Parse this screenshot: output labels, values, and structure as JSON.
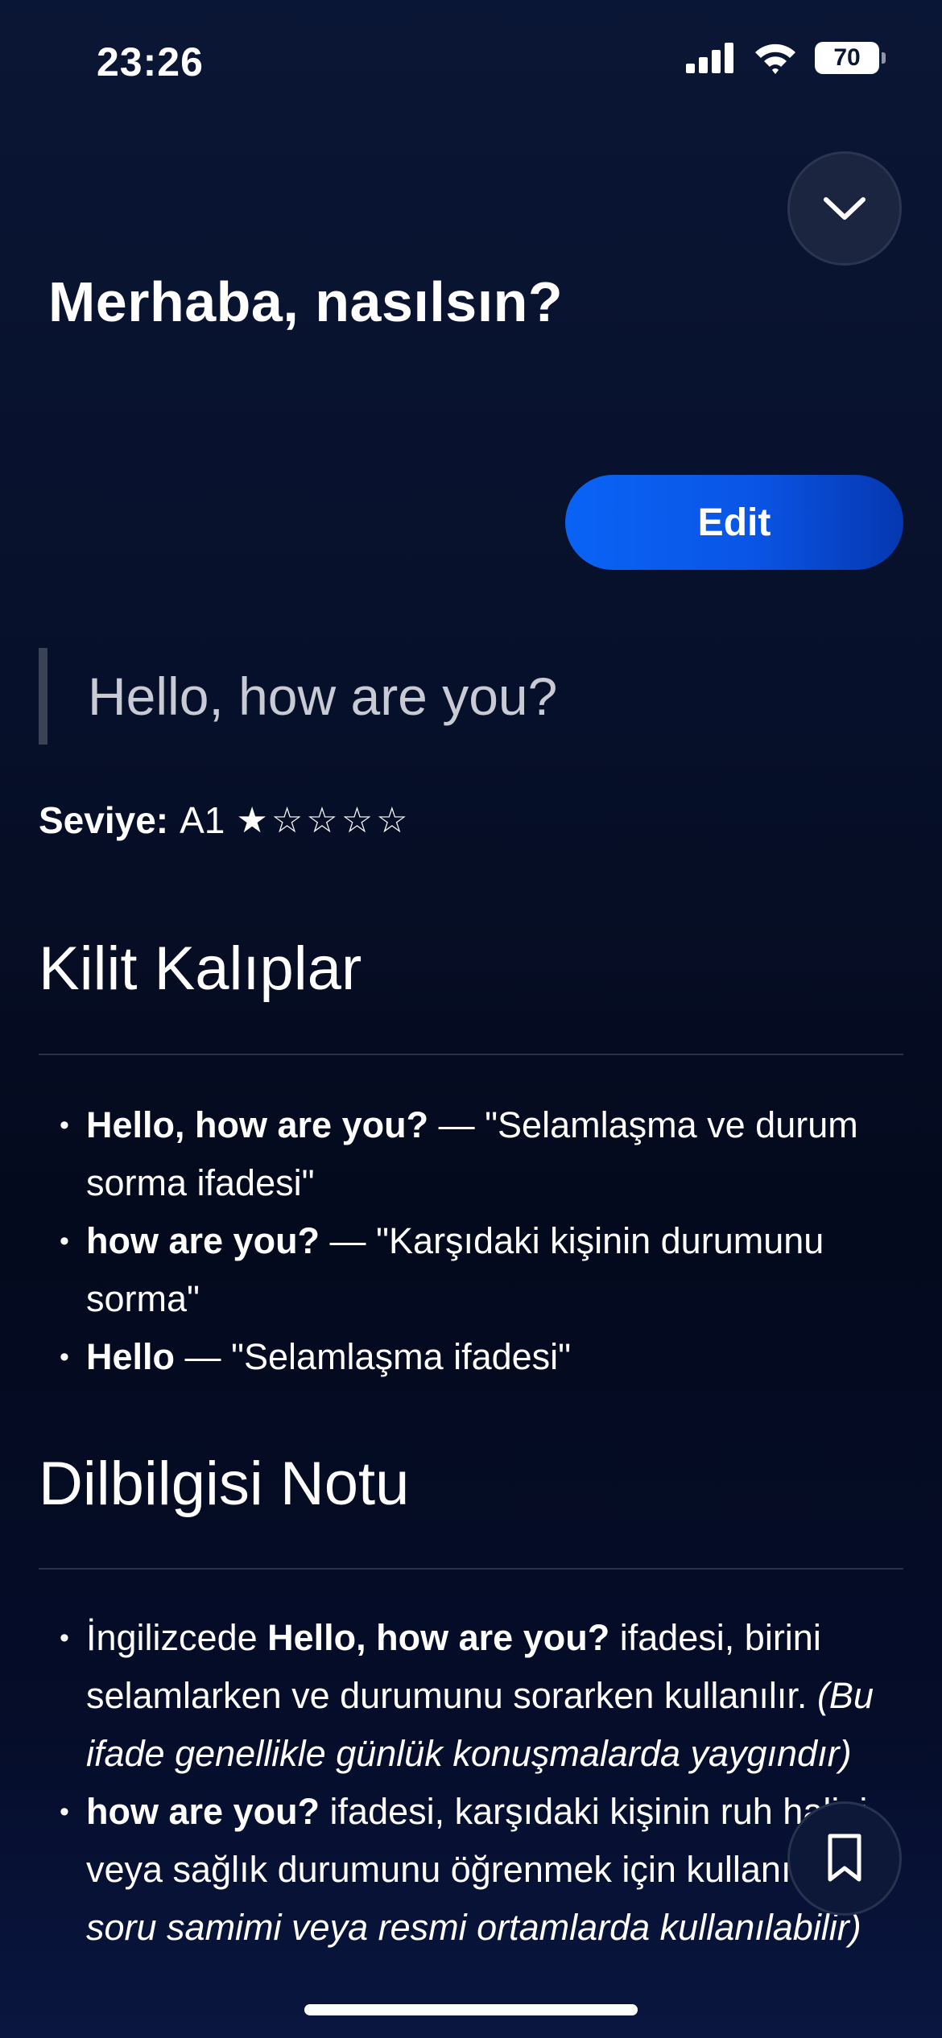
{
  "status_bar": {
    "time": "23:26",
    "battery": "70",
    "icons": [
      "signal-icon",
      "wifi-icon",
      "battery-icon"
    ]
  },
  "header": {
    "collapse_icon": "chevron-down-icon",
    "title": "Merhaba, nasılsın?"
  },
  "edit_label": "Edit",
  "quote": "Hello, how are you?",
  "level": {
    "label": "Seviye:",
    "value": "A1",
    "stars": "★☆☆☆☆",
    "rating": 1,
    "max": 5
  },
  "sections": {
    "patterns": {
      "title": "Kilit Kalıplar",
      "items": [
        {
          "bold": "Hello, how are you?",
          "text": " — \"Selamlaşma ve durum sorma ifadesi\""
        },
        {
          "bold": "how are you?",
          "text": " — \"Karşıdaki kişinin durumunu sorma\""
        },
        {
          "bold": "Hello",
          "text": " — \"Selamlaşma ifadesi\""
        }
      ]
    },
    "grammar": {
      "title": "Dilbilgisi Notu",
      "items": [
        {
          "pre": "İngilizcede ",
          "bold": "Hello, how are you?",
          "text": " ifadesi, birini selamlarken ve durumunu sorarken kullanılır. ",
          "italic": "(Bu ifade genellikle günlük konuşmalarda yaygındır)"
        },
        {
          "pre": "",
          "bold": "how are you?",
          "text": " ifadesi, karşıdaki kişinin ruh halini veya sağlık durumunu öğrenmek için kullanılır. ",
          "italic": "(Bu soru samimi veya resmi ortamlarda kullanılabilir)"
        }
      ]
    }
  },
  "bookmark_icon": "bookmark-icon",
  "colors": {
    "background": "#07102a",
    "accent": "#0a63f5",
    "divider": "#2a3247"
  }
}
